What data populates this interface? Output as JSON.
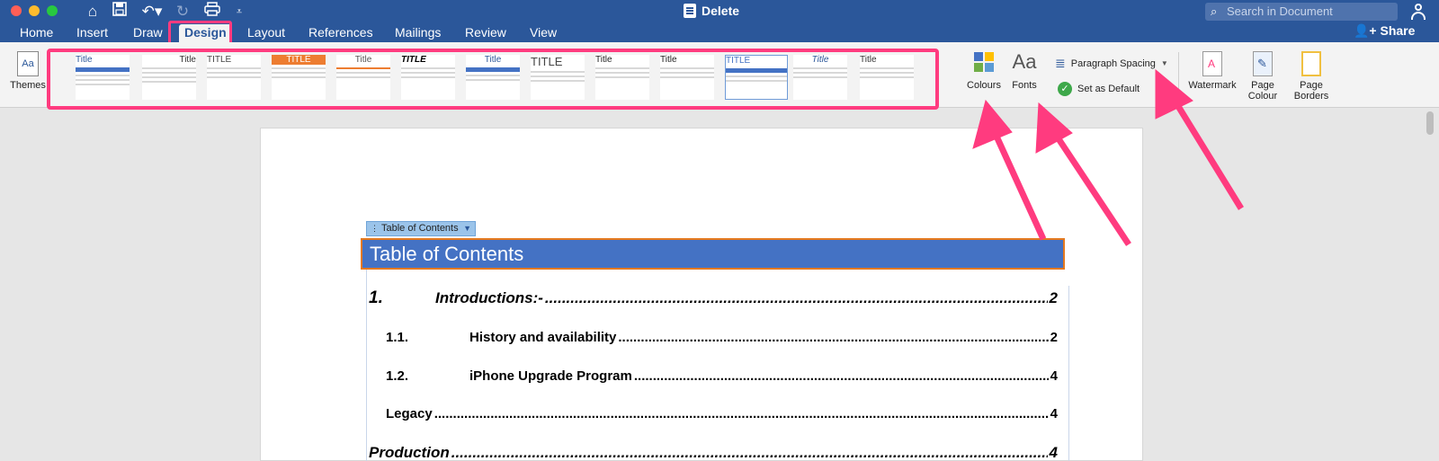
{
  "window": {
    "title": "Delete",
    "search_placeholder": "Search in Document",
    "share_label": "Share"
  },
  "tabs": [
    {
      "label": "Home"
    },
    {
      "label": "Insert"
    },
    {
      "label": "Draw"
    },
    {
      "label": "Design"
    },
    {
      "label": "Layout"
    },
    {
      "label": "References"
    },
    {
      "label": "Mailings"
    },
    {
      "label": "Review"
    },
    {
      "label": "View"
    }
  ],
  "active_tab": "Design",
  "ribbon": {
    "themes_label": "Themes",
    "colours_label": "Colours",
    "fonts_label": "Fonts",
    "paragraph_spacing_label": "Paragraph Spacing",
    "set_as_default_label": "Set as Default",
    "watermark_label": "Watermark",
    "page_colour_label": "Page Colour",
    "page_borders_label": "Page Borders",
    "style_set_titles": [
      "Title",
      "Title",
      "TITLE",
      "TITLE",
      "Title",
      "TITLE",
      "Title",
      "TITLE",
      "Title",
      "Title",
      "TITLE",
      "Title",
      "Title",
      "Title"
    ]
  },
  "document": {
    "toc_tag_label": "Table of Contents",
    "toc_heading": "Table of Contents",
    "entries": [
      {
        "num": "1.",
        "text": "Introductions:-",
        "page": "2"
      },
      {
        "num": "1.1.",
        "text": "History and availability",
        "page": "2"
      },
      {
        "num": "1.2.",
        "text": "iPhone Upgrade Program",
        "page": "4"
      },
      {
        "num": "",
        "text": "Legacy",
        "page": "4"
      },
      {
        "num": "",
        "text": "Production",
        "page": "4"
      }
    ]
  },
  "colors": {
    "ribbon_blue": "#2b579a",
    "annotation_pink": "#ff3b7f",
    "heading_fill": "#4472c4",
    "heading_border": "#e4791f"
  },
  "icons": [
    "home-icon",
    "save-icon",
    "undo-icon",
    "redo-icon",
    "print-icon",
    "customize-icon",
    "search-icon",
    "user-icon",
    "share-icon",
    "themes-icon",
    "colours-icon",
    "fonts-icon",
    "paragraph-spacing-icon",
    "check-icon",
    "watermark-icon",
    "page-colour-icon",
    "page-borders-icon"
  ]
}
